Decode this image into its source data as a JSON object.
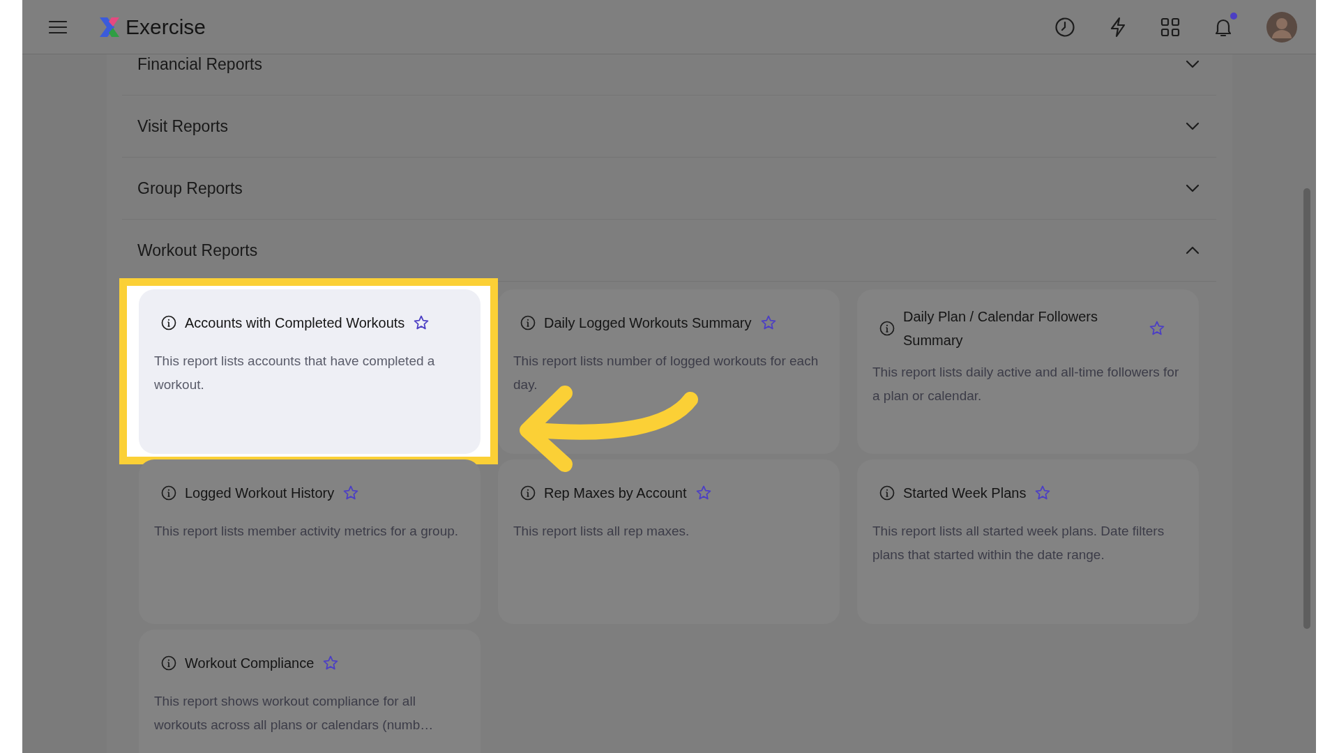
{
  "app": {
    "title": "Exercise"
  },
  "notifications": {
    "unread": true
  },
  "sections": [
    {
      "title": "Financial Reports",
      "expanded": false
    },
    {
      "title": "Visit Reports",
      "expanded": false
    },
    {
      "title": "Group Reports",
      "expanded": false
    },
    {
      "title": "Workout Reports",
      "expanded": true,
      "reports": [
        {
          "title": "Accounts with Completed Workouts",
          "description": "This report lists accounts that have completed a workout.",
          "starred": false,
          "highlighted": true
        },
        {
          "title": "Daily Logged Workouts Summary",
          "description": "This report lists number of logged workouts for each day.",
          "starred": false,
          "highlighted": false
        },
        {
          "title": "Daily Plan / Calendar Followers Summary",
          "description": "This report lists daily active and all-time followers for a plan or calendar.",
          "starred": false,
          "highlighted": false
        },
        {
          "title": "Logged Workout History",
          "description": "This report lists member activity metrics for a group.",
          "starred": false,
          "highlighted": false
        },
        {
          "title": "Rep Maxes by Account",
          "description": "This report lists all rep maxes.",
          "starred": false,
          "highlighted": false
        },
        {
          "title": "Started Week Plans",
          "description": "This report lists all started week plans. Date filters plans that started within the date range.",
          "starred": false,
          "highlighted": false
        },
        {
          "title": "Workout Compliance",
          "description": "This report shows workout compliance for all workouts across all plans or calendars (numb…",
          "starred": false,
          "highlighted": false
        }
      ]
    }
  ]
}
